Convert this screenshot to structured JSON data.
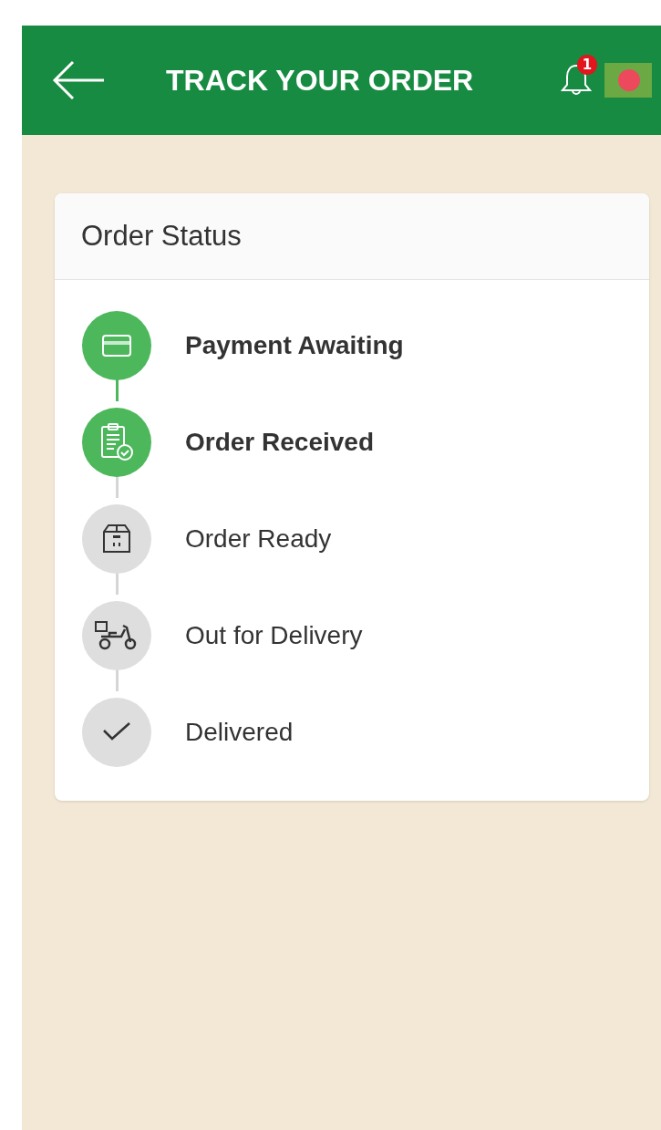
{
  "header": {
    "title": "TRACK YOUR ORDER",
    "notification_count": "1"
  },
  "order_status": {
    "title": "Order Status",
    "steps": [
      {
        "label": "Payment Awaiting",
        "kind": "card",
        "done": true
      },
      {
        "label": "Order Received",
        "kind": "clipboard",
        "done": true
      },
      {
        "label": "Order Ready",
        "kind": "box",
        "done": false
      },
      {
        "label": "Out for Delivery",
        "kind": "scooter",
        "done": false
      },
      {
        "label": "Delivered",
        "kind": "check",
        "done": false
      }
    ]
  }
}
